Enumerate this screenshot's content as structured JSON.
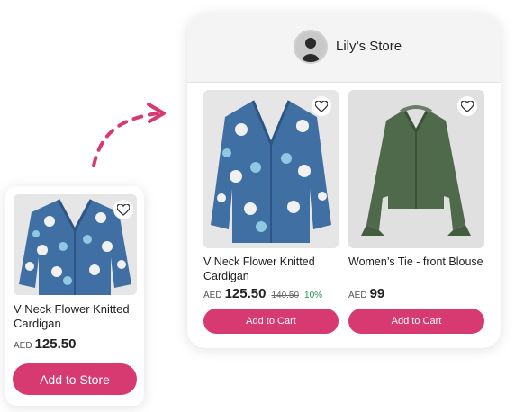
{
  "single_product": {
    "title": "V Neck Flower Knitted Cardigan",
    "currency": "AED",
    "price": "125.50",
    "button_label": "Add to Store"
  },
  "store": {
    "name": "Lily’s Store",
    "products": [
      {
        "title": "V Neck Flower Knitted Cardigan",
        "currency": "AED",
        "price": "125.50",
        "old_price": "140.50",
        "discount": "10%",
        "button_label": "Add to Cart"
      },
      {
        "title": "Women’s Tie - front Blouse",
        "currency": "AED",
        "price": "99",
        "button_label": "Add to Cart"
      }
    ]
  },
  "colors": {
    "accent": "#d73a70",
    "discount": "#2f8f5b",
    "cardigan": "#3f6fa3",
    "blouse": "#4f6a4a"
  }
}
